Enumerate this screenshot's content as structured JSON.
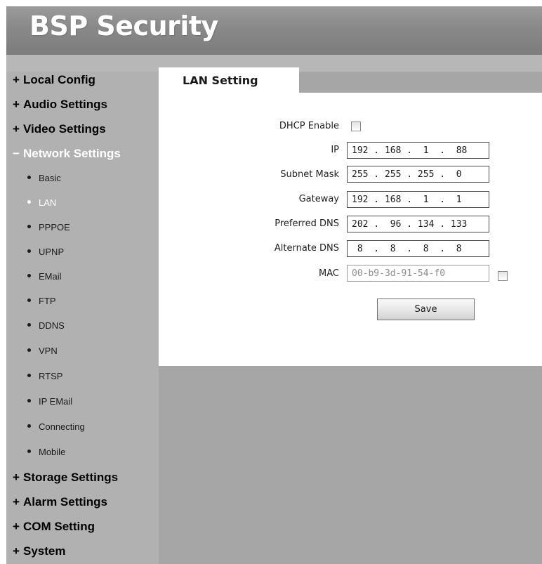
{
  "header": {
    "brand": "BSP Security"
  },
  "sidebar": {
    "categories_top": [
      {
        "sign": "+",
        "label": "Local Config"
      },
      {
        "sign": "+",
        "label": "Audio Settings"
      },
      {
        "sign": "+",
        "label": "Video Settings"
      },
      {
        "sign": "−",
        "label": "Network Settings"
      }
    ],
    "sub_items": [
      {
        "label": "Basic"
      },
      {
        "label": "LAN"
      },
      {
        "label": "PPPOE"
      },
      {
        "label": "UPNP"
      },
      {
        "label": "EMail"
      },
      {
        "label": "FTP"
      },
      {
        "label": "DDNS"
      },
      {
        "label": "VPN"
      },
      {
        "label": "RTSP"
      },
      {
        "label": "IP EMail"
      },
      {
        "label": "Connecting"
      },
      {
        "label": "Mobile"
      }
    ],
    "categories_bottom": [
      {
        "sign": "+",
        "label": "Storage Settings"
      },
      {
        "sign": "+",
        "label": "Alarm Settings"
      },
      {
        "sign": "+",
        "label": "COM Setting"
      },
      {
        "sign": "+",
        "label": "System"
      }
    ],
    "active_category": "Network Settings",
    "active_item": "LAN"
  },
  "tab": {
    "label": "LAN Setting"
  },
  "form": {
    "dhcp": {
      "label": "DHCP Enable",
      "checked": false
    },
    "ip": {
      "label": "IP",
      "value": "192 . 168 .  1  .  88"
    },
    "subnet": {
      "label": "Subnet Mask",
      "value": "255 . 255 . 255 .  0"
    },
    "gateway": {
      "label": "Gateway",
      "value": "192 . 168 .  1  .  1"
    },
    "dns1": {
      "label": "Preferred DNS",
      "value": "202 .  96 . 134 . 133"
    },
    "dns2": {
      "label": "Alternate DNS",
      "value": " 8  .  8  .  8  .  8"
    },
    "mac": {
      "label": "MAC",
      "value": "00-b9-3d-91-54-f0",
      "edit_checked": false
    },
    "save_label": "Save"
  },
  "colors": {
    "header": "#8a8a8a",
    "sidebar": "#b1b1b1",
    "main_bg": "#a6a6a6",
    "panel": "#ffffff",
    "active_text": "#ffffff"
  }
}
